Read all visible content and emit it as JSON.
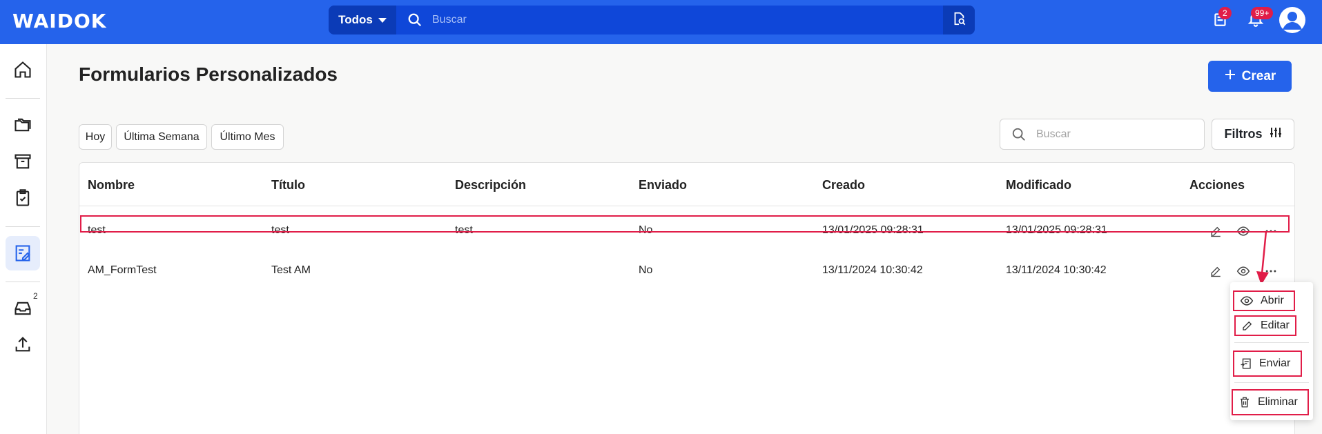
{
  "app": {
    "logo": "WAIDOK"
  },
  "topbar": {
    "scope_label": "Todos",
    "search_placeholder": "Buscar",
    "notifications_badge": "2",
    "alerts_badge": "99+"
  },
  "sidebar": {
    "inbox_badge": "2",
    "items": [
      "home-icon",
      "folders-icon",
      "archive-icon",
      "clipboard-check-icon",
      "forms-icon",
      "inbox-icon",
      "upload-icon"
    ]
  },
  "page": {
    "title": "Formularios Personalizados",
    "create_label": "Crear"
  },
  "filters": {
    "chips": [
      "Hoy",
      "Última Semana",
      "Último Mes"
    ],
    "search_placeholder": "Buscar",
    "filters_label": "Filtros"
  },
  "table": {
    "columns": [
      "Nombre",
      "Título",
      "Descripción",
      "Enviado",
      "Creado",
      "Modificado",
      "Acciones"
    ],
    "rows": [
      {
        "nombre": "test",
        "titulo": "test",
        "descripcion": "test",
        "enviado": "No",
        "creado": "13/01/2025 09:28:31",
        "modificado": "13/01/2025 09:28:31"
      },
      {
        "nombre": "AM_FormTest",
        "titulo": "Test AM",
        "descripcion": "",
        "enviado": "No",
        "creado": "13/11/2024 10:30:42",
        "modificado": "13/11/2024 10:30:42"
      }
    ]
  },
  "menu": {
    "open_label": "Abrir",
    "edit_label": "Editar",
    "send_label": "Enviar",
    "delete_label": "Eliminar"
  },
  "colors": {
    "brand": "#2563eb",
    "highlight": "#e11d48"
  }
}
